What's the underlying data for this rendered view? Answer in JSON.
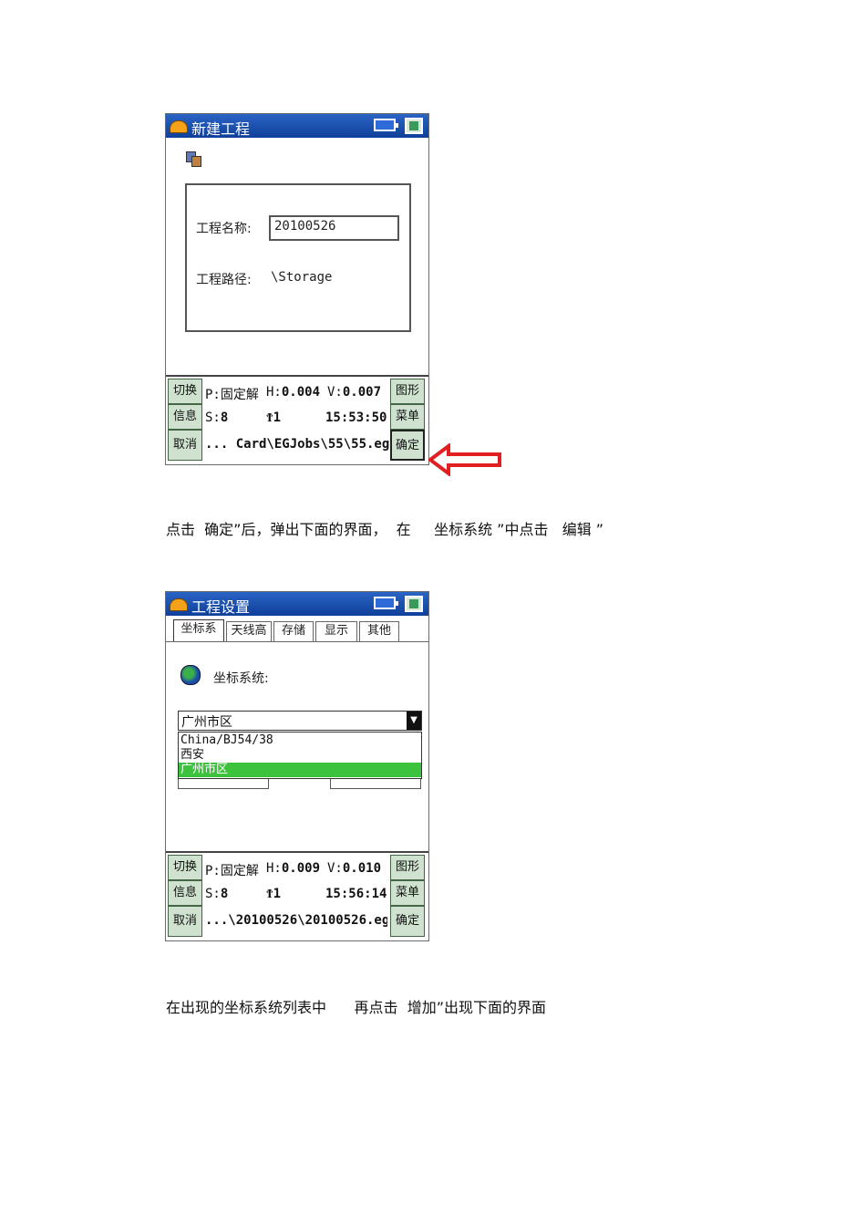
{
  "dialog1": {
    "title": "新建工程",
    "name_label": "工程名称:",
    "name_value": "20100526",
    "path_label": "工程路径:",
    "path_value": "\\Storage",
    "status": {
      "btn_switch": "切换",
      "btn_info": "信息",
      "btn_cancel": "取消",
      "btn_graph": "图形",
      "btn_menu": "菜单",
      "btn_ok": "确定",
      "p_label": "P:",
      "p_value": "固定解",
      "h_label": "H:",
      "h_value": "0.004",
      "v_label": "V:",
      "v_value": "0.007",
      "s_label": "S:",
      "s_value": "8",
      "antenna": "1",
      "time": "15:53:50",
      "file_path": "... Card\\EGJobs\\55\\55.eg"
    }
  },
  "caption1": "点击  确定”后，弹出下面的界面，  在     坐标系统 ”中点击   编辑 ”",
  "dialog2": {
    "title": "工程设置",
    "tabs": [
      "坐标系",
      "天线高",
      "存储",
      "显示",
      "其他"
    ],
    "coord_label": "坐标系统:",
    "combo_value": "广州市区",
    "dropdown_items": [
      "China/BJ54/38",
      "西安",
      "广州市区"
    ],
    "status": {
      "btn_switch": "切换",
      "btn_info": "信息",
      "btn_cancel": "取消",
      "btn_graph": "图形",
      "btn_menu": "菜单",
      "btn_ok": "确定",
      "p_label": "P:",
      "p_value": "固定解",
      "h_label": "H:",
      "h_value": "0.009",
      "v_label": "V:",
      "v_value": "0.010",
      "s_label": "S:",
      "s_value": "8",
      "antenna": "1",
      "time": "15:56:14",
      "file_path": "...\\20100526\\20100526.eg"
    }
  },
  "caption2": "在出现的坐标系统列表中      再点击  增加”出现下面的界面",
  "colors": {
    "titlebar": "#1a4fb0",
    "button_bg": "#cfe2cf",
    "selection": "#3cc23c",
    "arrow": "#e02020"
  }
}
